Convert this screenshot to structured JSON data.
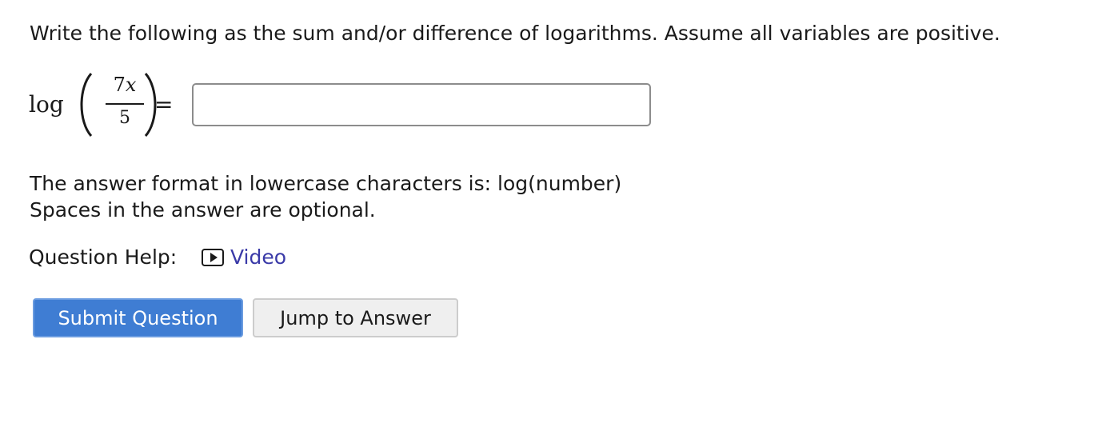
{
  "question": {
    "prompt": "Write the following as the sum and/or difference of logarithms. Assume all variables are positive."
  },
  "expression": {
    "function": "log",
    "numerator_coefficient": "7",
    "numerator_variable": "x",
    "denominator": "5",
    "equals": "="
  },
  "answer": {
    "value": "",
    "placeholder": ""
  },
  "instructions": {
    "line1": "The answer format in lowercase characters is: log(number)",
    "line2": "Spaces in the answer are optional."
  },
  "help": {
    "label": "Question Help:",
    "video_label": "Video",
    "icon": "play-video-icon"
  },
  "buttons": {
    "submit_label": "Submit Question",
    "jump_label": "Jump to Answer"
  },
  "colors": {
    "submit_bg": "#3f7dd3",
    "link": "#3a3aa8"
  }
}
